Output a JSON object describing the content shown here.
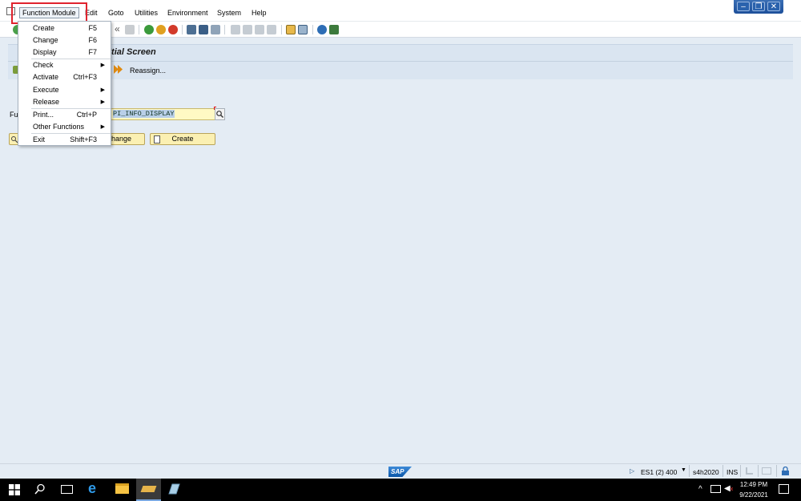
{
  "menubar": {
    "items": [
      {
        "label": "Function Module"
      },
      {
        "label": "Edit"
      },
      {
        "label": "Goto"
      },
      {
        "label": "Utilities"
      },
      {
        "label": "Environment"
      },
      {
        "label": "System"
      },
      {
        "label": "Help"
      }
    ]
  },
  "dropdown": {
    "items": [
      {
        "label": "Create",
        "shortcut": "F5"
      },
      {
        "label": "Change",
        "shortcut": "F6"
      },
      {
        "label": "Display",
        "shortcut": "F7"
      },
      {
        "label": "Check",
        "shortcut": ""
      },
      {
        "label": "Activate",
        "shortcut": "Ctrl+F3"
      },
      {
        "label": "Execute",
        "shortcut": ""
      },
      {
        "label": "Release",
        "shortcut": ""
      },
      {
        "label": "Print...",
        "shortcut": "Ctrl+P"
      },
      {
        "label": "Other Functions",
        "shortcut": ""
      },
      {
        "label": "Exit",
        "shortcut": "Shift+F3"
      }
    ]
  },
  "title": {
    "text": "itial Screen"
  },
  "app_toolbar": {
    "reassign_label": "Reassign..."
  },
  "form": {
    "fm_label_partial": "Fu",
    "fm_value": "PI_INFO_DISPLAY",
    "change_label": "hange",
    "create_label": "Create"
  },
  "statusbar": {
    "session": "ES1 (2) 400",
    "server": "s4h2020",
    "mode": "INS"
  },
  "taskbar": {
    "time": "12:49 PM",
    "date": "9/22/2021"
  },
  "colors": {
    "accent_highlight": "#e0232e",
    "background": "#e4ecf4",
    "input_bg": "#fff9c4"
  }
}
